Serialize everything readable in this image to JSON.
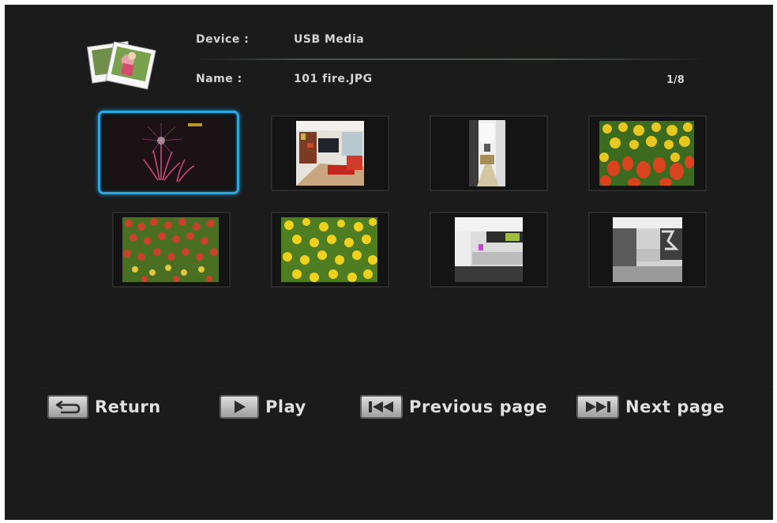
{
  "header": {
    "device_label": "Device :",
    "device_value": "USB Media",
    "name_label": "Name :",
    "name_value": "101 fire.JPG",
    "page_counter": "1/8"
  },
  "thumbnails": [
    {
      "subject": "fireworks",
      "selected": true
    },
    {
      "subject": "living-room-interior",
      "selected": false
    },
    {
      "subject": "hallway-interior",
      "selected": false
    },
    {
      "subject": "tulip-field-red-yellow",
      "selected": false
    },
    {
      "subject": "tulip-field-red",
      "selected": false
    },
    {
      "subject": "tulip-field-yellow",
      "selected": false
    },
    {
      "subject": "modern-kitchen",
      "selected": false
    },
    {
      "subject": "modern-kitchen-2",
      "selected": false
    }
  ],
  "footer": {
    "return_label": "Return",
    "play_label": "Play",
    "prev_label": "Previous page",
    "next_label": "Next page"
  },
  "colors": {
    "background": "#1b1b1b",
    "selection": "#2aa8e0",
    "text": "#d4d4d4"
  },
  "icons": {
    "album": "photo-album-icon",
    "return": "return-icon",
    "play": "play-icon",
    "prev": "previous-page-icon",
    "next": "next-page-icon"
  }
}
